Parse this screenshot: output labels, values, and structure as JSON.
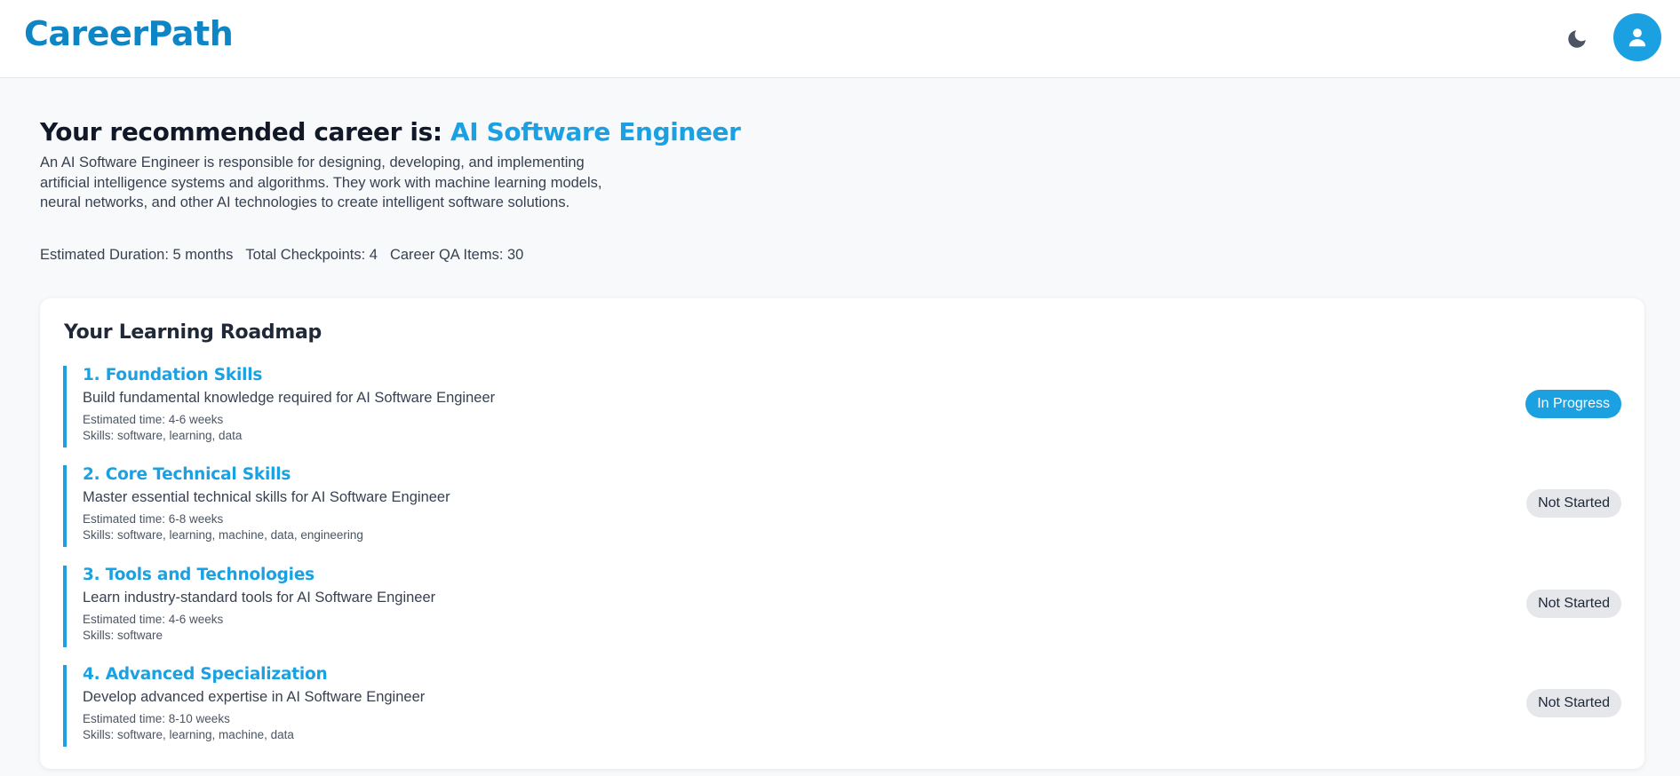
{
  "header": {
    "logo": "CareerPath",
    "theme_icon": "moon-icon",
    "profile_icon": "user-icon"
  },
  "recommendation": {
    "prefix": "Your recommended career is: ",
    "career": "AI Software Engineer",
    "description": "An AI Software Engineer is responsible for designing, developing, and implementing artificial intelligence systems and algorithms. They work with machine learning models, neural networks, and other AI technologies to create intelligent software solutions.",
    "stats": {
      "duration": "Estimated Duration: 5 months",
      "checkpoints": "Total Checkpoints: 4",
      "qa_items": "Career QA Items: 30"
    }
  },
  "roadmap": {
    "title": "Your Learning Roadmap",
    "steps": [
      {
        "title": "1. Foundation Skills",
        "description": "Build fundamental knowledge required for AI Software Engineer",
        "time": "Estimated time: 4-6 weeks",
        "skills": "Skills: software, learning, data",
        "status": "In Progress"
      },
      {
        "title": "2. Core Technical Skills",
        "description": "Master essential technical skills for AI Software Engineer",
        "time": "Estimated time: 6-8 weeks",
        "skills": "Skills: software, learning, machine, data, engineering",
        "status": "Not Started"
      },
      {
        "title": "3. Tools and Technologies",
        "description": "Learn industry-standard tools for AI Software Engineer",
        "time": "Estimated time: 4-6 weeks",
        "skills": "Skills: software",
        "status": "Not Started"
      },
      {
        "title": "4. Advanced Specialization",
        "description": "Develop advanced expertise in AI Software Engineer",
        "time": "Estimated time: 8-10 weeks",
        "skills": "Skills: software, learning, machine, data",
        "status": "Not Started"
      }
    ]
  },
  "colors": {
    "accent": "#1ba1e2",
    "logo": "#0e86c6",
    "badge_inactive": "#e5e7eb"
  }
}
